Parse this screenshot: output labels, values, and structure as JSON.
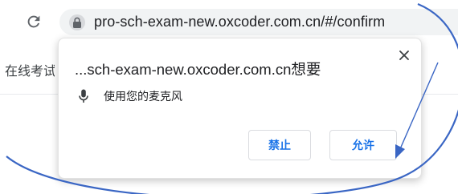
{
  "browser": {
    "url": "pro-sch-exam-new.oxcoder.com.cn/#/confirm"
  },
  "page": {
    "partial_text": "在线考试"
  },
  "permission_popup": {
    "title": "...sch-exam-new.oxcoder.com.cn想要",
    "close_glyph": "✕",
    "permission_label": "使用您的麦克风",
    "block_label": "禁止",
    "allow_label": "允许"
  },
  "colors": {
    "accent_blue": "#1a73e8",
    "annotation_stroke": "#3a66c4"
  },
  "icons": {
    "reload": "reload-icon",
    "lock": "lock-icon",
    "mic": "microphone-icon",
    "close": "close-icon"
  }
}
